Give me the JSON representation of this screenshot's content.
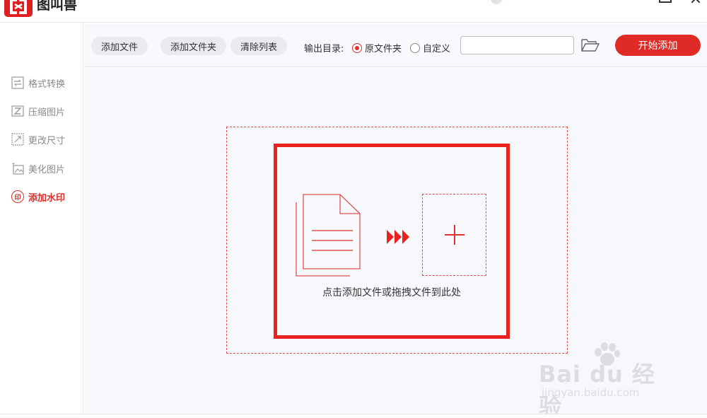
{
  "app": {
    "title": "图叫兽"
  },
  "sidebar": {
    "items": [
      {
        "label": "格式转换",
        "icon": "convert-icon"
      },
      {
        "label": "压缩图片",
        "icon": "compress-icon"
      },
      {
        "label": "更改尺寸",
        "icon": "resize-icon"
      },
      {
        "label": "美化图片",
        "icon": "beautify-icon"
      },
      {
        "label": "添加水印",
        "icon": "stamp-icon",
        "active": true,
        "badge": "印"
      }
    ]
  },
  "toolbar": {
    "add_file": "添加文件",
    "add_folder": "添加文件夹",
    "clear_list": "清除列表",
    "output_label": "输出目录:",
    "radio_original": "原文件夹",
    "radio_custom": "自定义",
    "selected_output": "原文件夹",
    "path_value": "",
    "start": "开始添加"
  },
  "main": {
    "drop_hint": "点击添加文件或拖拽文件到此处"
  },
  "colors": {
    "accent": "#e02a26",
    "highlight_border": "#e8221f",
    "dashed": "#e05252",
    "background": "#f6f8fc"
  },
  "watermark": {
    "main": "Bai du 经验",
    "sub": "jingyan.baidu.com"
  }
}
